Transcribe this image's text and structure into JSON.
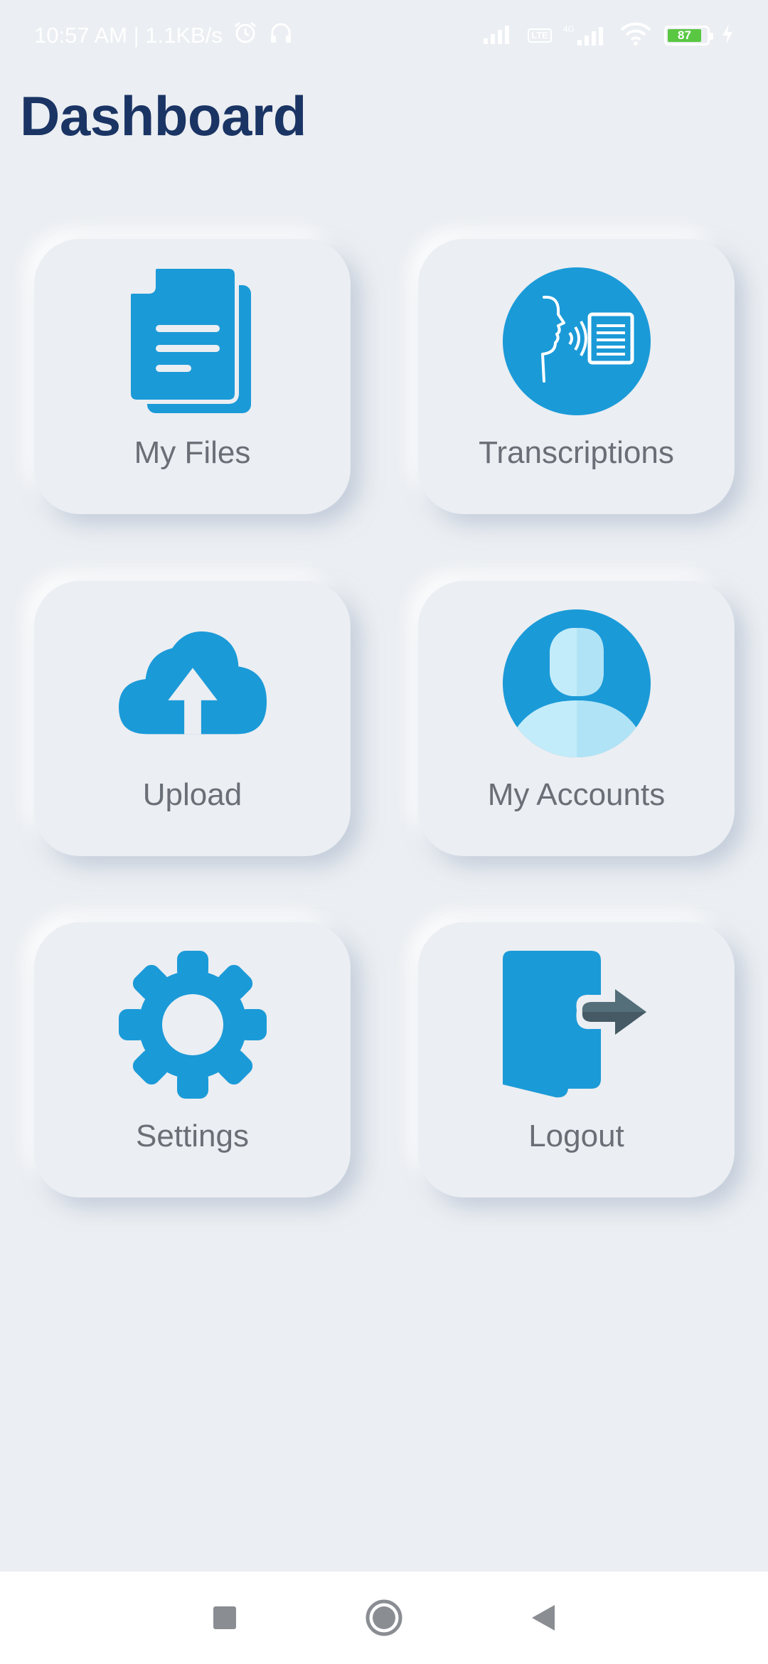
{
  "status_bar": {
    "time_speed": "10:57 AM | 1.1KB/s",
    "battery_level": "87",
    "net_badge": "LTE",
    "net_type": "4G"
  },
  "page": {
    "title": "Dashboard"
  },
  "tiles": [
    {
      "label": "My Files",
      "icon": "documents-icon"
    },
    {
      "label": "Transcriptions",
      "icon": "speech-to-text-icon"
    },
    {
      "label": "Upload",
      "icon": "cloud-upload-icon"
    },
    {
      "label": "My Accounts",
      "icon": "user-icon"
    },
    {
      "label": "Settings",
      "icon": "gear-icon"
    },
    {
      "label": "Logout",
      "icon": "logout-icon"
    }
  ],
  "nav_bar": {
    "items": [
      "recents-button",
      "home-button",
      "back-button"
    ]
  },
  "colors": {
    "accent": "#1b9ad8",
    "title": "#1a3464",
    "background": "#ebeef2",
    "label": "#6a6e76"
  }
}
